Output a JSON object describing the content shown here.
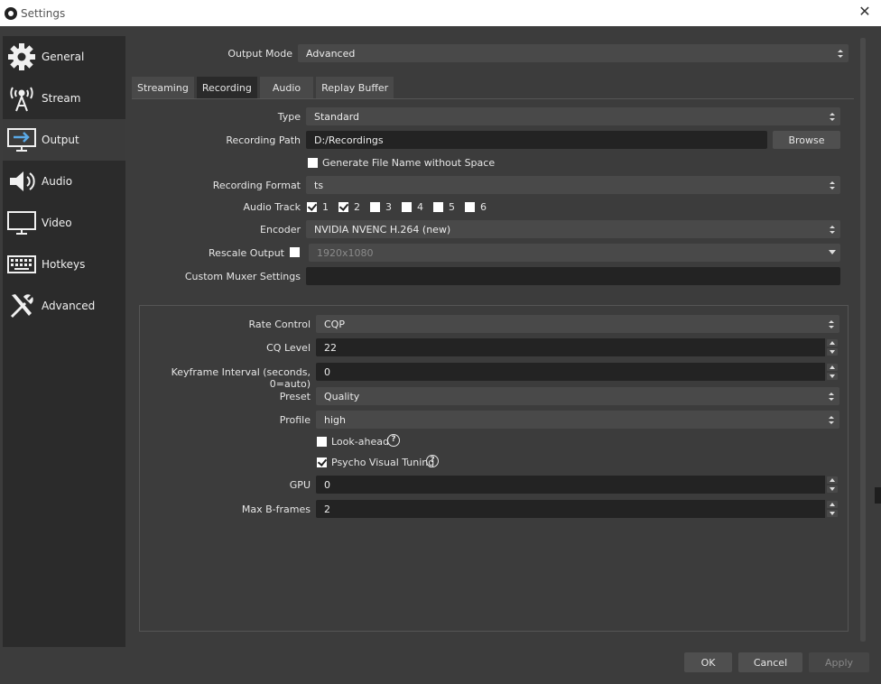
{
  "window": {
    "title": "Settings",
    "close_glyph": "✕"
  },
  "sidebar": {
    "items": [
      {
        "label": "General",
        "icon": "gear-icon"
      },
      {
        "label": "Stream",
        "icon": "broadcast-icon"
      },
      {
        "label": "Output",
        "icon": "monitor-arrow-icon"
      },
      {
        "label": "Audio",
        "icon": "speaker-icon"
      },
      {
        "label": "Video",
        "icon": "monitor-icon"
      },
      {
        "label": "Hotkeys",
        "icon": "keyboard-icon"
      },
      {
        "label": "Advanced",
        "icon": "tools-icon"
      }
    ],
    "active": "Output"
  },
  "output_mode": {
    "label": "Output Mode",
    "value": "Advanced"
  },
  "tabs": [
    {
      "label": "Streaming"
    },
    {
      "label": "Recording"
    },
    {
      "label": "Audio"
    },
    {
      "label": "Replay Buffer"
    }
  ],
  "active_tab": "Recording",
  "recording": {
    "type": {
      "label": "Type",
      "value": "Standard"
    },
    "path": {
      "label": "Recording Path",
      "value": "D:/Recordings",
      "browse_label": "Browse"
    },
    "gen_filename": {
      "label": "Generate File Name without Space",
      "checked": false
    },
    "format": {
      "label": "Recording Format",
      "value": "ts"
    },
    "audio_track": {
      "label": "Audio Track",
      "tracks": [
        {
          "label": "1",
          "checked": true
        },
        {
          "label": "2",
          "checked": true
        },
        {
          "label": "3",
          "checked": false
        },
        {
          "label": "4",
          "checked": false
        },
        {
          "label": "5",
          "checked": false
        },
        {
          "label": "6",
          "checked": false
        }
      ]
    },
    "encoder": {
      "label": "Encoder",
      "value": "NVIDIA NVENC H.264 (new)"
    },
    "rescale": {
      "label": "Rescale Output",
      "checked": false,
      "value": "1920x1080"
    },
    "muxer": {
      "label": "Custom Muxer Settings",
      "value": ""
    }
  },
  "encoder_settings": {
    "rate_control": {
      "label": "Rate Control",
      "value": "CQP"
    },
    "cq_level": {
      "label": "CQ Level",
      "value": "22"
    },
    "keyframe": {
      "label": "Keyframe Interval (seconds, 0=auto)",
      "value": "0"
    },
    "preset": {
      "label": "Preset",
      "value": "Quality"
    },
    "profile": {
      "label": "Profile",
      "value": "high"
    },
    "lookahead": {
      "label": "Look-ahead",
      "checked": false,
      "help": "?"
    },
    "psycho": {
      "label": "Psycho Visual Tuning",
      "checked": true,
      "help": "?"
    },
    "gpu": {
      "label": "GPU",
      "value": "0"
    },
    "bframes": {
      "label": "Max B-frames",
      "value": "2"
    }
  },
  "footer": {
    "ok": "OK",
    "cancel": "Cancel",
    "apply": "Apply"
  }
}
